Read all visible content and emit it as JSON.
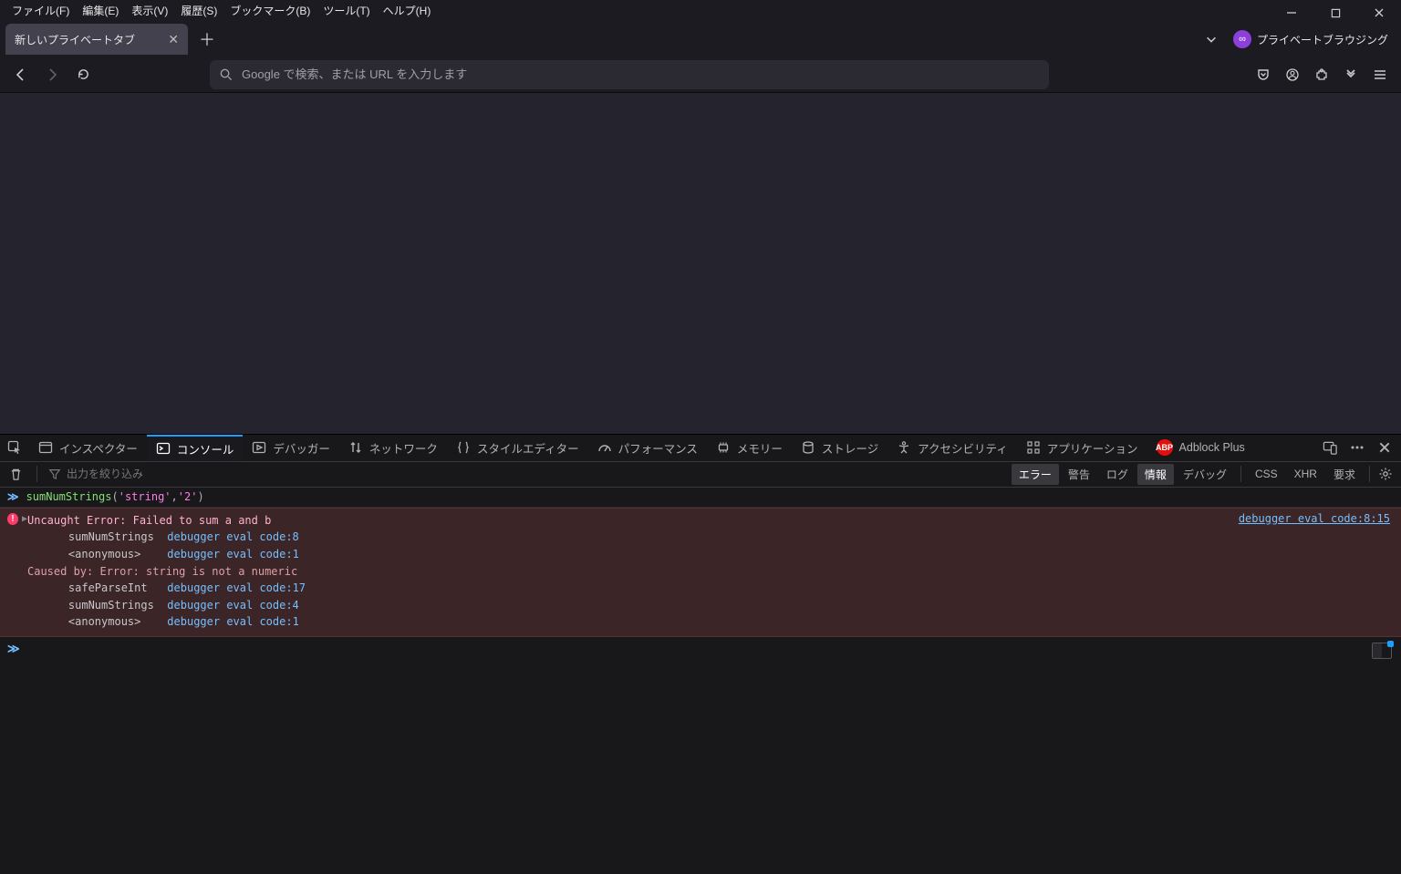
{
  "menubar": {
    "items": [
      "ファイル(F)",
      "編集(E)",
      "表示(V)",
      "履歴(S)",
      "ブックマーク(B)",
      "ツール(T)",
      "ヘルプ(H)"
    ]
  },
  "tabs": {
    "active": {
      "title": "新しいプライベートタブ"
    },
    "private_label": "プライベートブラウジング"
  },
  "addressbar": {
    "placeholder": "Google で検索、または URL を入力します"
  },
  "devtools": {
    "tabs": {
      "inspector": "インスペクター",
      "console": "コンソール",
      "debugger": "デバッガー",
      "network": "ネットワーク",
      "styleEditor": "スタイルエディター",
      "performance": "パフォーマンス",
      "memory": "メモリー",
      "storage": "ストレージ",
      "accessibility": "アクセシビリティ",
      "application": "アプリケーション",
      "adblock": "Adblock Plus"
    },
    "filterbar": {
      "placeholder": "出力を絞り込み",
      "errors": "エラー",
      "warnings": "警告",
      "logs": "ログ",
      "info": "情報",
      "debug": "デバッグ",
      "css": "CSS",
      "xhr": "XHR",
      "requests": "要求"
    },
    "executed": {
      "fn": "sumNumStrings",
      "arg1": "'string'",
      "arg2": "'2'"
    },
    "error": {
      "link": "debugger eval code:8:15",
      "message": "Uncaught Error: Failed to sum a and b",
      "stack1_fn": "sumNumStrings",
      "stack1_loc": "debugger eval code:8",
      "stack2_fn": "<anonymous>",
      "stack2_loc": "debugger eval code:1",
      "caused_by": "Caused by: Error: string is not a numeric",
      "stack3_fn": "safeParseInt",
      "stack3_loc": "debugger eval code:17",
      "stack4_fn": "sumNumStrings",
      "stack4_loc": "debugger eval code:4",
      "stack5_fn": "<anonymous>",
      "stack5_loc": "debugger eval code:1"
    }
  }
}
